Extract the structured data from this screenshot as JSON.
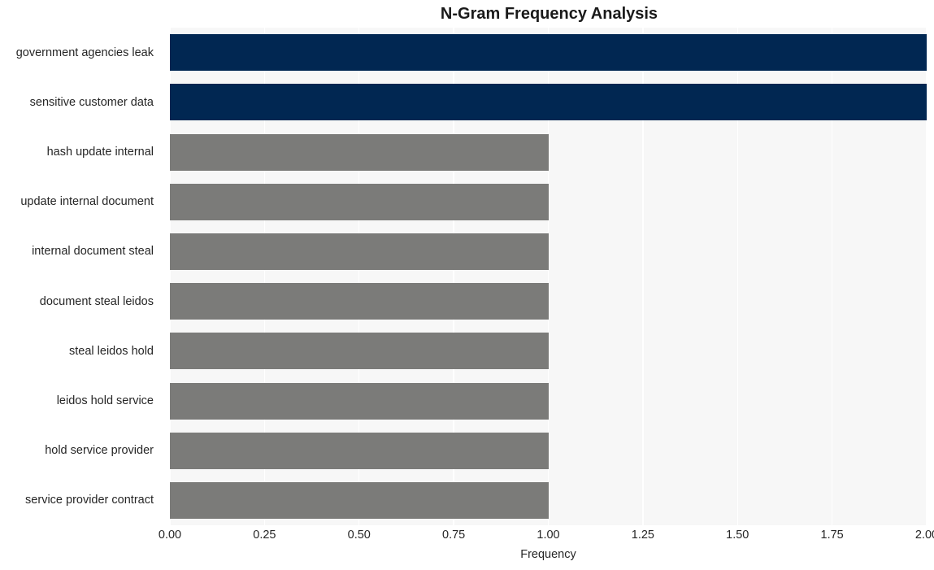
{
  "chart_data": {
    "type": "bar",
    "orientation": "horizontal",
    "title": "N-Gram Frequency Analysis",
    "xlabel": "Frequency",
    "ylabel": "",
    "xlim": [
      0,
      2
    ],
    "ylim": null,
    "grid": true,
    "legend": null,
    "xticks": [
      "0.00",
      "0.25",
      "0.50",
      "0.75",
      "1.00",
      "1.25",
      "1.50",
      "1.75",
      "2.00"
    ],
    "xtick_values": [
      0,
      0.25,
      0.5,
      0.75,
      1.0,
      1.25,
      1.5,
      1.75,
      2.0
    ],
    "categories": [
      "government agencies leak",
      "sensitive customer data",
      "hash update internal",
      "update internal document",
      "internal document steal",
      "document steal leidos",
      "steal leidos hold",
      "leidos hold service",
      "hold service provider",
      "service provider contract"
    ],
    "values": [
      2,
      2,
      1,
      1,
      1,
      1,
      1,
      1,
      1,
      1
    ],
    "bar_colors": [
      "#012752",
      "#012752",
      "#7b7b79",
      "#7b7b79",
      "#7b7b79",
      "#7b7b79",
      "#7b7b79",
      "#7b7b79",
      "#7b7b79",
      "#7b7b79"
    ],
    "colors": {
      "high": "#012752",
      "low": "#7b7b79",
      "plot_background": "#f7f7f7",
      "gridline": "#ffffff",
      "figure_background": "#ffffff",
      "text": "#262626",
      "title_text": "#1a1a1a"
    }
  }
}
